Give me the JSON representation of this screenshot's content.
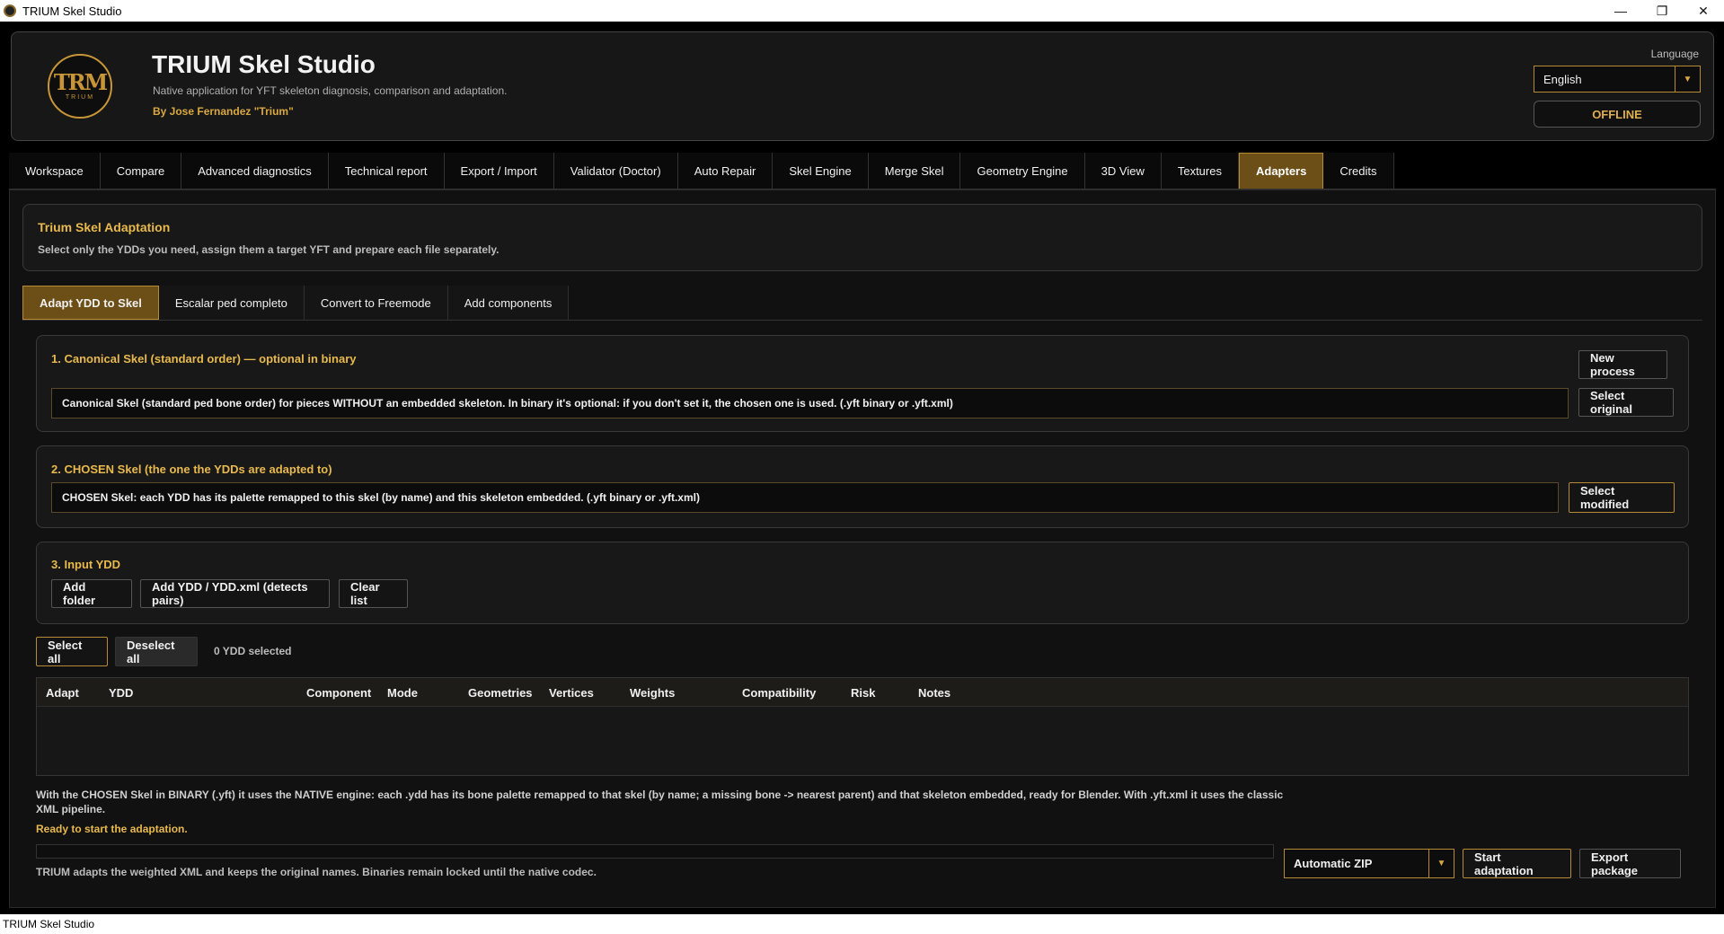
{
  "window": {
    "title": "TRIUM Skel Studio",
    "minimize": "—",
    "maximize": "❐",
    "close": "✕"
  },
  "header": {
    "logo_mark": "TRM",
    "logo_sub": "TRIUM",
    "title": "TRIUM Skel Studio",
    "subtitle": "Native application for YFT skeleton diagnosis, comparison and adaptation.",
    "author": "By Jose Fernandez \"Trium\"",
    "language_label": "Language",
    "language_value": "English",
    "status": "OFFLINE"
  },
  "main_tabs": [
    "Workspace",
    "Compare",
    "Advanced diagnostics",
    "Technical report",
    "Export / Import",
    "Validator (Doctor)",
    "Auto Repair",
    "Skel Engine",
    "Merge Skel",
    "Geometry Engine",
    "3D View",
    "Textures",
    "Adapters",
    "Credits"
  ],
  "active_main_tab": "Adapters",
  "adaptation": {
    "title": "Trium Skel Adaptation",
    "description": "Select only the YDDs you need, assign them a target YFT and prepare each file separately."
  },
  "sub_tabs": [
    "Adapt YDD to Skel",
    "Escalar ped completo",
    "Convert to Freemode",
    "Add components"
  ],
  "active_sub_tab": "Adapt YDD to Skel",
  "section1": {
    "title": "1. Canonical Skel (standard order) — optional in binary",
    "field": "Canonical Skel (standard ped bone order) for pieces WITHOUT an embedded skeleton. In binary it's optional: if you don't set it, the chosen one is used. (.yft binary or .yft.xml)",
    "new_process": "New process",
    "select_original": "Select original"
  },
  "section2": {
    "title": "2. CHOSEN Skel (the one the YDDs are adapted to)",
    "field": "CHOSEN Skel: each YDD has its palette remapped to this skel (by name) and this skeleton embedded. (.yft binary or .yft.xml)",
    "select_modified": "Select modified"
  },
  "section3": {
    "title": "3. Input YDD",
    "add_folder": "Add folder",
    "add_ydd": "Add YDD / YDD.xml (detects pairs)",
    "clear_list": "Clear list"
  },
  "selection": {
    "select_all": "Select all",
    "deselect_all": "Deselect all",
    "count": "0 YDD selected"
  },
  "table": {
    "columns": [
      "Adapt",
      "YDD",
      "Component",
      "Mode",
      "Geometries",
      "Vertices",
      "Weights",
      "Compatibility",
      "Risk",
      "Notes"
    ],
    "rows": []
  },
  "footer": {
    "info": "With the CHOSEN Skel in BINARY (.yft) it uses the NATIVE engine: each .ydd has its bone palette remapped to that skel (by name; a missing bone -> nearest parent) and that skeleton embedded, ready for Blender. With .yft.xml it uses the classic XML pipeline.",
    "status": "Ready to start the adaptation.",
    "progress": 0,
    "note": "TRIUM adapts the weighted XML and keeps the original names. Binaries remain locked until the native codec.",
    "output_mode": "Automatic ZIP",
    "start": "Start adaptation",
    "export": "Export package"
  },
  "statusbar": {
    "text": "TRIUM Skel Studio"
  },
  "colors": {
    "accent": "#d9a940",
    "active_tab": "#6b4f17",
    "background": "#111111"
  },
  "icons": {
    "dropdown": "chevron-down-icon",
    "app": "app-icon"
  }
}
